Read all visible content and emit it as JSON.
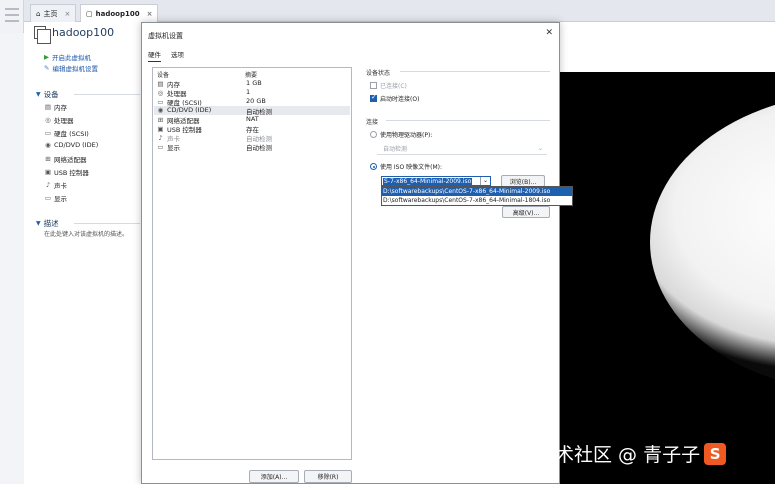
{
  "tabs": [
    {
      "label": "主页",
      "icon": "home-icon"
    },
    {
      "label": "hadoop100",
      "icon": "vm-icon"
    }
  ],
  "vm": {
    "name": "hadoop100",
    "actions": [
      {
        "label": "开启此虚拟机",
        "icon": "play-icon"
      },
      {
        "label": "编辑虚拟机设置",
        "icon": "edit-icon"
      }
    ],
    "devices_header": "设备",
    "devices": [
      {
        "label": "内存",
        "icon": "memory-icon"
      },
      {
        "label": "处理器",
        "icon": "cpu-icon"
      },
      {
        "label": "硬盘 (SCSI)",
        "icon": "disk-icon"
      },
      {
        "label": "CD/DVD (IDE)",
        "icon": "cd-icon"
      },
      {
        "label": "网络适配器",
        "icon": "network-icon"
      },
      {
        "label": "USB 控制器",
        "icon": "usb-icon"
      },
      {
        "label": "声卡",
        "icon": "sound-icon"
      },
      {
        "label": "显示",
        "icon": "display-icon"
      }
    ],
    "description_header": "描述",
    "description_text": "在此处键入对该虚拟机的描述。"
  },
  "dialog": {
    "title": "虚拟机设置",
    "tabs": [
      "硬件",
      "选项"
    ],
    "table_headers": {
      "device": "设备",
      "summary": "摘要"
    },
    "hardware": [
      {
        "device": "内存",
        "summary": "1 GB",
        "icon": "memory-icon"
      },
      {
        "device": "处理器",
        "summary": "1",
        "icon": "cpu-icon"
      },
      {
        "device": "硬盘 (SCSI)",
        "summary": "20 GB",
        "icon": "disk-icon"
      },
      {
        "device": "CD/DVD (IDE)",
        "summary": "自动检测",
        "icon": "cd-icon"
      },
      {
        "device": "网络适配器",
        "summary": "NAT",
        "icon": "network-icon"
      },
      {
        "device": "USB 控制器",
        "summary": "存在",
        "icon": "usb-icon"
      },
      {
        "device": "声卡",
        "summary": "自动检测",
        "icon": "sound-icon"
      },
      {
        "device": "显示",
        "summary": "自动检测",
        "icon": "display-icon"
      }
    ],
    "selected_index": 3,
    "add_button": "添加(A)...",
    "remove_button": "移除(R)",
    "device_status": {
      "header": "设备状态",
      "connected": "已连接(C)",
      "connect_at_power_on": "启动时连接(O)"
    },
    "connection": {
      "header": "连接",
      "physical_drive": "使用物理驱动器(P):",
      "physical_drive_value": "自动检测",
      "iso": "使用 ISO 映像文件(M):",
      "iso_value": "S-7-x86_64-Minimal-2009.iso",
      "iso_options": [
        "D:\\softwarebackups\\CentOS-7-x86_64-Minimal-2009.iso",
        "D:\\softwarebackups\\CentOS-7-x86_64-Minimal-1804.iso"
      ],
      "browse_button": "浏览(B)...",
      "advanced_button": "高级(V)..."
    }
  },
  "watermark": {
    "text": "掘金技术社区 @ 青子子",
    "logo_letter": "S"
  },
  "colors": {
    "accent": "#1f5fb0",
    "watermark_logo": "#f05a22"
  }
}
